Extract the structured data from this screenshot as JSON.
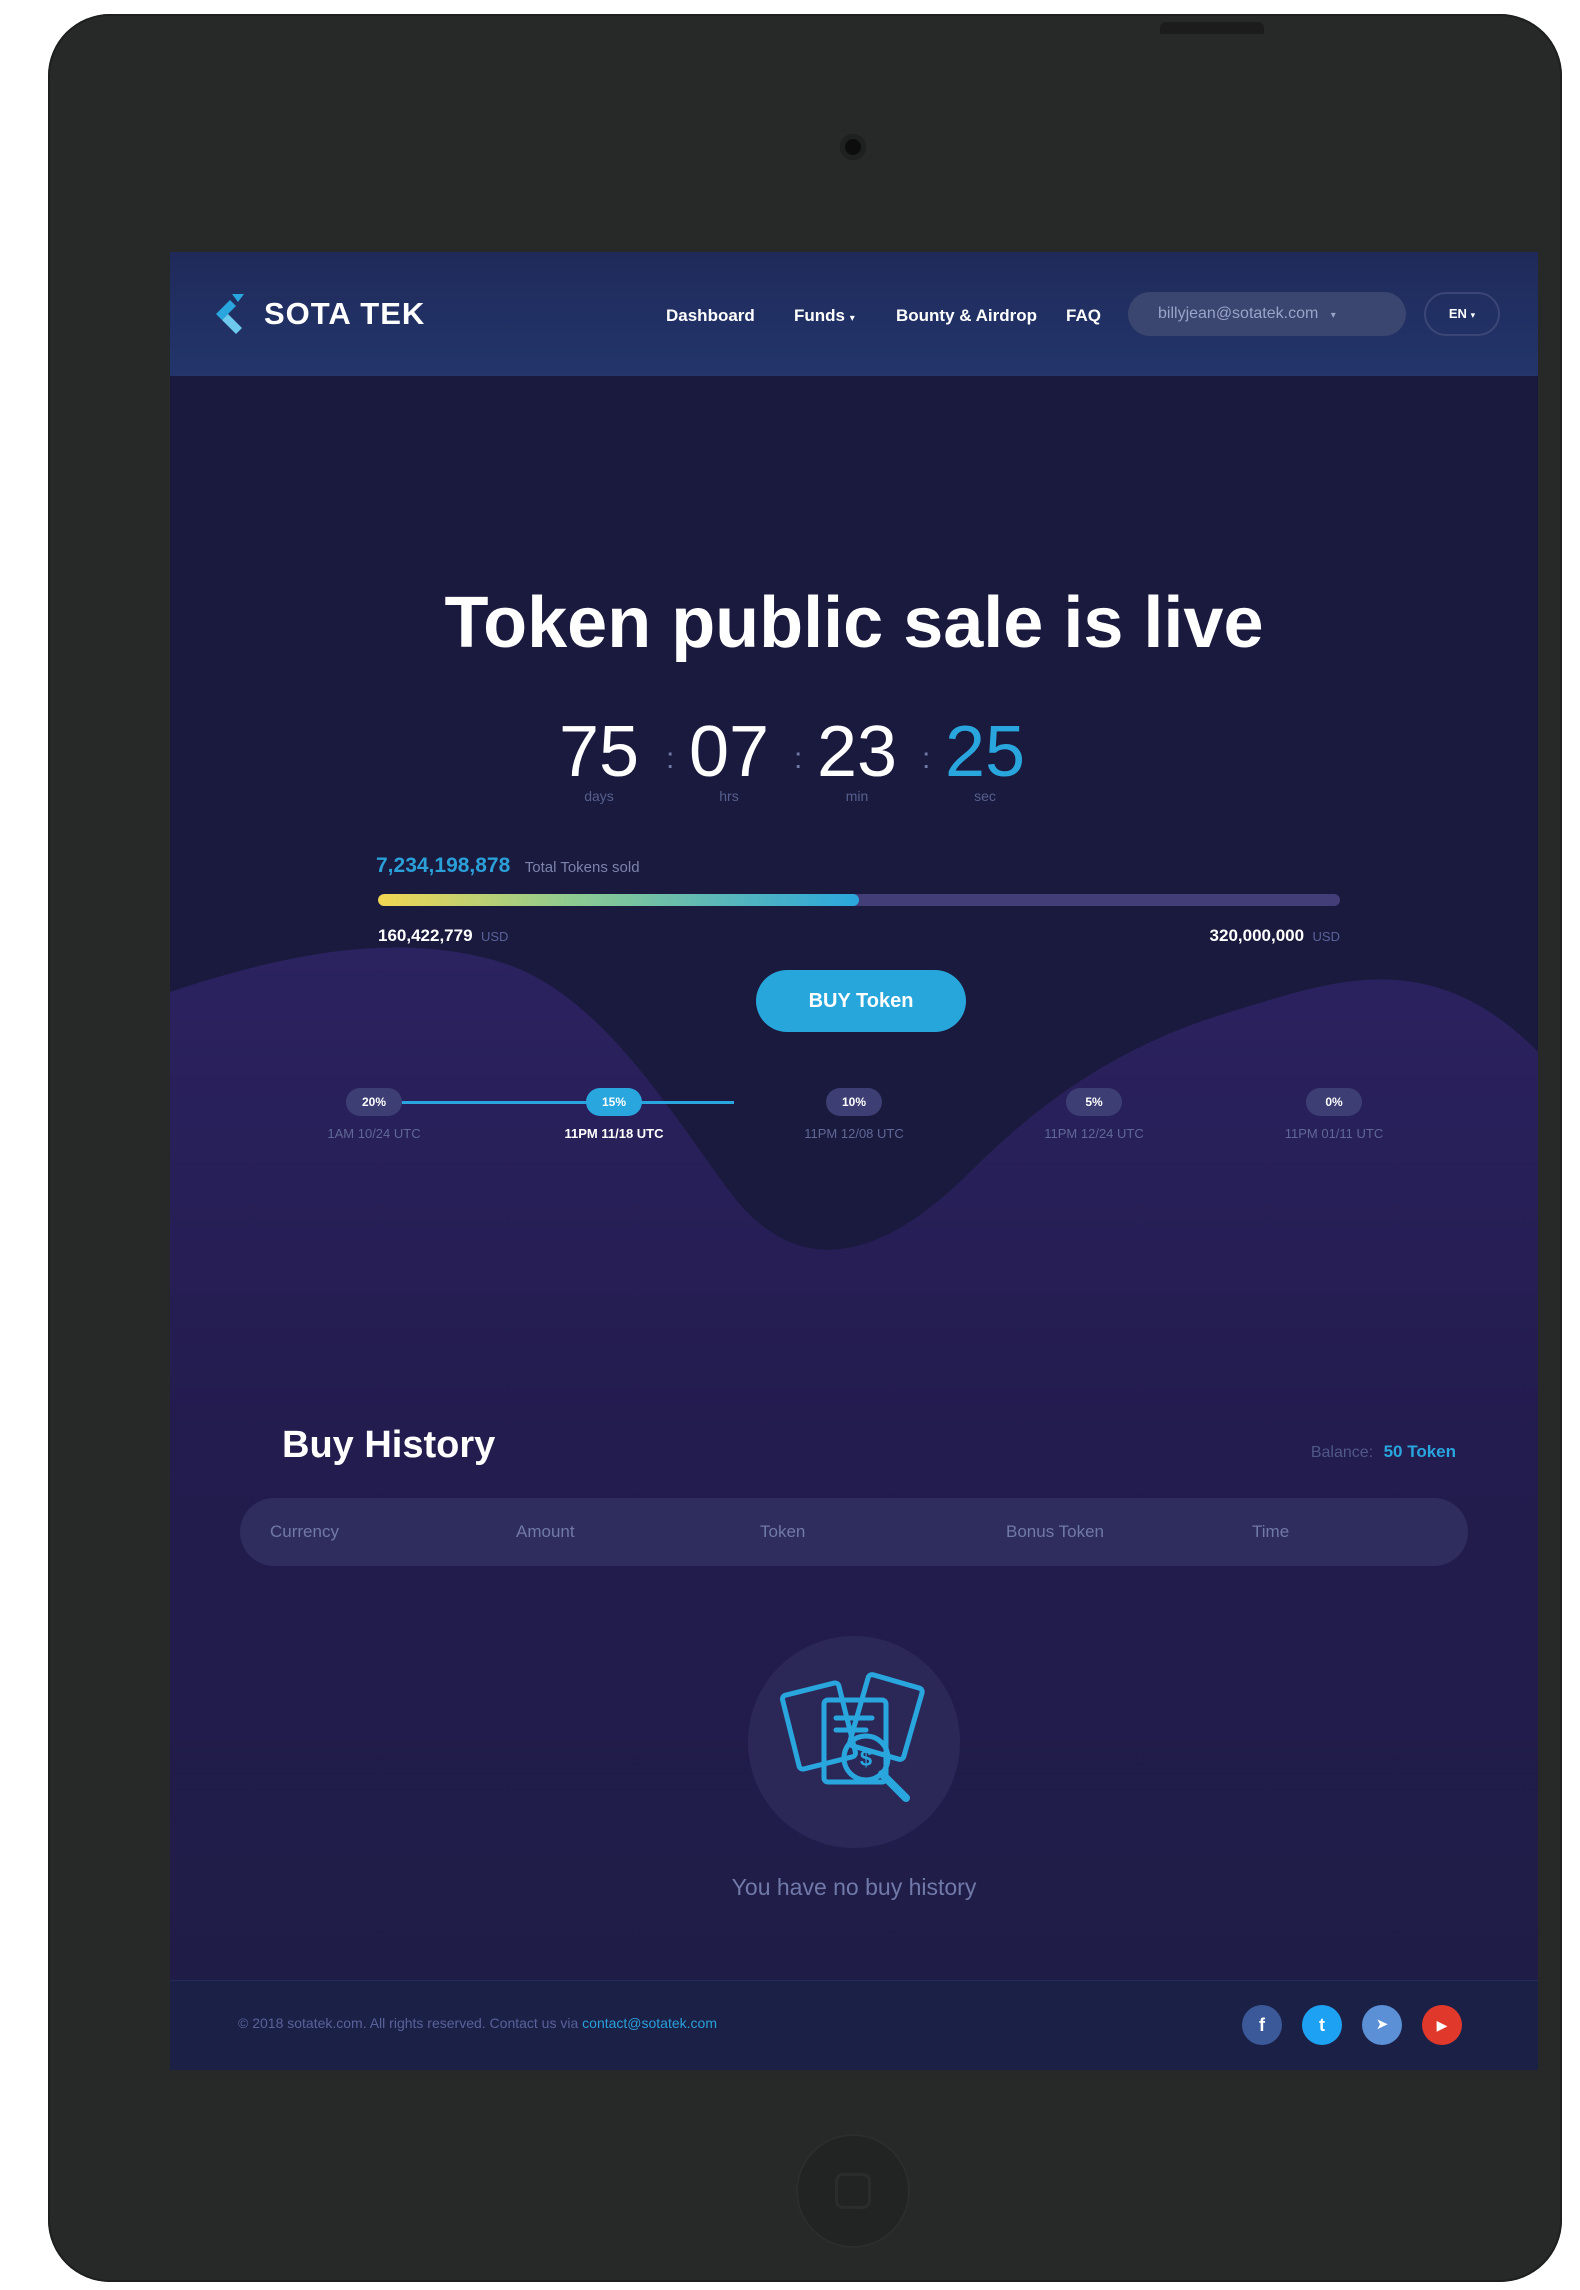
{
  "brand": {
    "name": "SOTA TEK",
    "accent": "#2aa6de",
    "background": "#1a1a3e"
  },
  "nav": {
    "items": [
      "Dashboard",
      "Funds",
      "Bounty & Airdrop",
      "FAQ"
    ],
    "email": "billyjean@sotatek.com",
    "language": "EN"
  },
  "hero": {
    "title": "Token public sale is live",
    "countdown": [
      {
        "value": "75",
        "unit": "days"
      },
      {
        "value": "07",
        "unit": "hrs"
      },
      {
        "value": "23",
        "unit": "min"
      },
      {
        "value": "25",
        "unit": "sec"
      }
    ],
    "tokens_sold": "7,234,198,878",
    "tokens_sold_label": "Total Tokens sold",
    "raised_usd": "160,422,779",
    "goal_usd": "320,000,000",
    "currency": "USD",
    "progress_fraction": 0.5,
    "buy_button": "BUY Token"
  },
  "timeline": [
    {
      "bonus": "20%",
      "date": "1AM 10/24 UTC",
      "active": false
    },
    {
      "bonus": "15%",
      "date": "11PM 11/18 UTC",
      "active": true
    },
    {
      "bonus": "10%",
      "date": "11PM 12/08 UTC",
      "active": false
    },
    {
      "bonus": "5%",
      "date": "11PM 12/24 UTC",
      "active": false
    },
    {
      "bonus": "0%",
      "date": "11PM 01/11 UTC",
      "active": false
    }
  ],
  "buy_history": {
    "title": "Buy History",
    "balance_label": "Balance:",
    "balance_value": "50 Token",
    "columns": [
      "Currency",
      "Amount",
      "Token",
      "Bonus Token",
      "Time"
    ],
    "empty_message": "You have no buy history"
  },
  "footer": {
    "copyright": "© 2018 sotatek.com. All rights reserved. Contact us via",
    "contact_email": "contact@sotatek.com",
    "social": [
      {
        "icon": "facebook-icon",
        "glyph": "f",
        "color": "#3b5998"
      },
      {
        "icon": "twitter-icon",
        "glyph": "t",
        "color": "#1da1f2"
      },
      {
        "icon": "telegram-icon",
        "glyph": "➤",
        "color": "#5b8fd6"
      },
      {
        "icon": "youtube-icon",
        "glyph": "▶",
        "color": "#e0392b"
      }
    ]
  }
}
